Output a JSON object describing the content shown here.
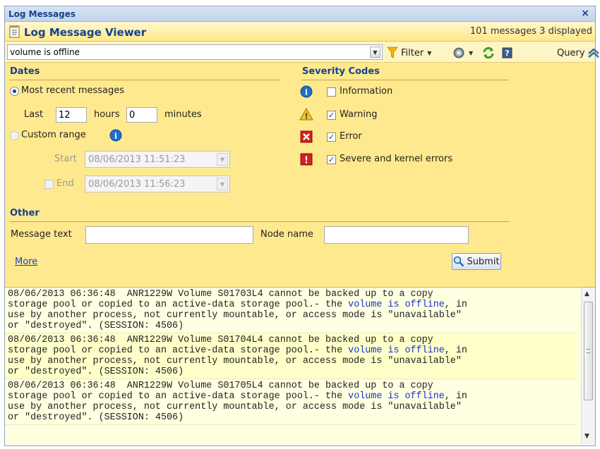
{
  "window": {
    "title": "Log Messages",
    "close_icon": "×"
  },
  "viewer": {
    "title": "Log Message Viewer",
    "counts": "101 messages  3 displayed"
  },
  "search": {
    "value": "volume is offline",
    "placeholder": ""
  },
  "toolbar": {
    "filter_label": "Filter",
    "query_label": "Query"
  },
  "dates": {
    "heading": "Dates",
    "most_recent_label": "Most recent messages",
    "last_label": "Last",
    "hours_value": "12",
    "hours_label": "hours",
    "minutes_value": "0",
    "minutes_label": "minutes",
    "custom_range_label": "Custom range",
    "start_label": "Start",
    "start_value": "08/06/2013 11:51:23",
    "end_label": "End",
    "end_value": "08/06/2013 11:56:23"
  },
  "severity": {
    "heading": "Severity Codes",
    "information_label": "Information",
    "warning_label": "Warning",
    "error_label": "Error",
    "severe_label": "Severe and kernel errors"
  },
  "other": {
    "heading": "Other",
    "message_text_label": "Message text",
    "node_name_label": "Node name",
    "more_label": "More",
    "submit_label": "Submit"
  },
  "log": {
    "highlight": "volume is offline",
    "entries": [
      {
        "line1": "08/06/2013 06:36:48  ANR1229W Volume S01703L4 cannot be backed up to a copy",
        "line2_pre": "storage pool or copied to an active-data storage pool.- the ",
        "line2_post": ", in",
        "line3": "use by another process, not currently mountable, or access mode is \"unavailable\"",
        "line4": "or \"destroyed\". (SESSION: 4506)"
      },
      {
        "line1": "08/06/2013 06:36:48  ANR1229W Volume S01704L4 cannot be backed up to a copy",
        "line2_pre": "storage pool or copied to an active-data storage pool.- the ",
        "line2_post": ", in",
        "line3": "use by another process, not currently mountable, or access mode is \"unavailable\"",
        "line4": "or \"destroyed\". (SESSION: 4506)"
      },
      {
        "line1": "08/06/2013 06:36:48  ANR1229W Volume S01705L4 cannot be backed up to a copy",
        "line2_pre": "storage pool or copied to an active-data storage pool.- the ",
        "line2_post": ", in",
        "line3": "use by another process, not currently mountable, or access mode is \"unavailable\"",
        "line4": "or \"destroyed\". (SESSION: 4506)"
      }
    ]
  }
}
